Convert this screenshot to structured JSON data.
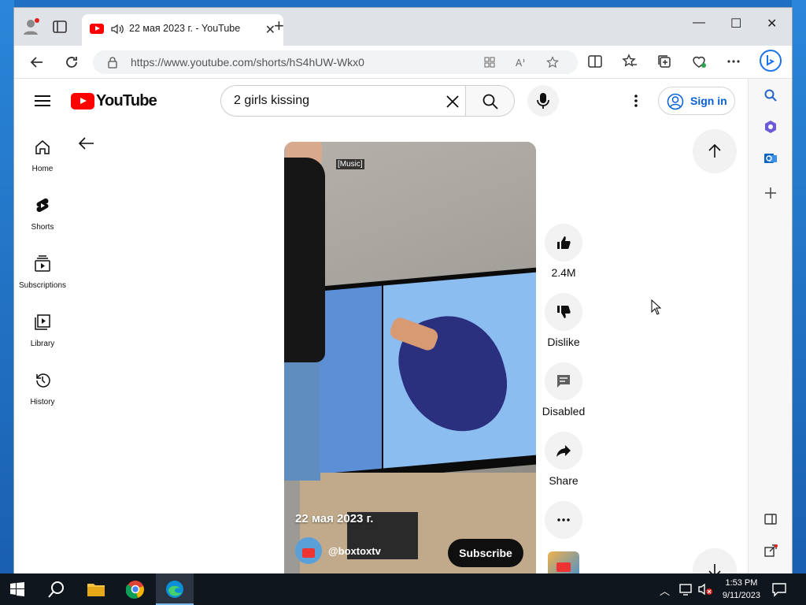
{
  "browser": {
    "tab_title": "22 мая 2023 г. - YouTube",
    "url": "https://www.youtube.com/shorts/hS4hUW-Wkx0",
    "window_controls": {
      "minimize": "—",
      "maximize": "☐",
      "close": "✕"
    }
  },
  "youtube": {
    "logo_text": "YouTube",
    "search_query": "2 girls kissing",
    "sign_in": "Sign in",
    "guide": [
      {
        "label": "Home",
        "icon": "home-icon"
      },
      {
        "label": "Shorts",
        "icon": "shorts-icon"
      },
      {
        "label": "Subscriptions",
        "icon": "subscriptions-icon"
      },
      {
        "label": "Library",
        "icon": "library-icon"
      },
      {
        "label": "History",
        "icon": "history-icon"
      }
    ]
  },
  "short": {
    "music_tag": "[Music]",
    "date": "22 мая 2023 г.",
    "channel": "@boxtoxtv",
    "subscribe": "Subscribe"
  },
  "actions": {
    "like_count": "2.4M",
    "dislike": "Dislike",
    "comments": "Disabled",
    "share": "Share"
  },
  "taskbar": {
    "time": "1:53 PM",
    "date": "9/11/2023"
  },
  "colors": {
    "youtube_red": "#ff0000",
    "link_blue": "#065fd4"
  }
}
